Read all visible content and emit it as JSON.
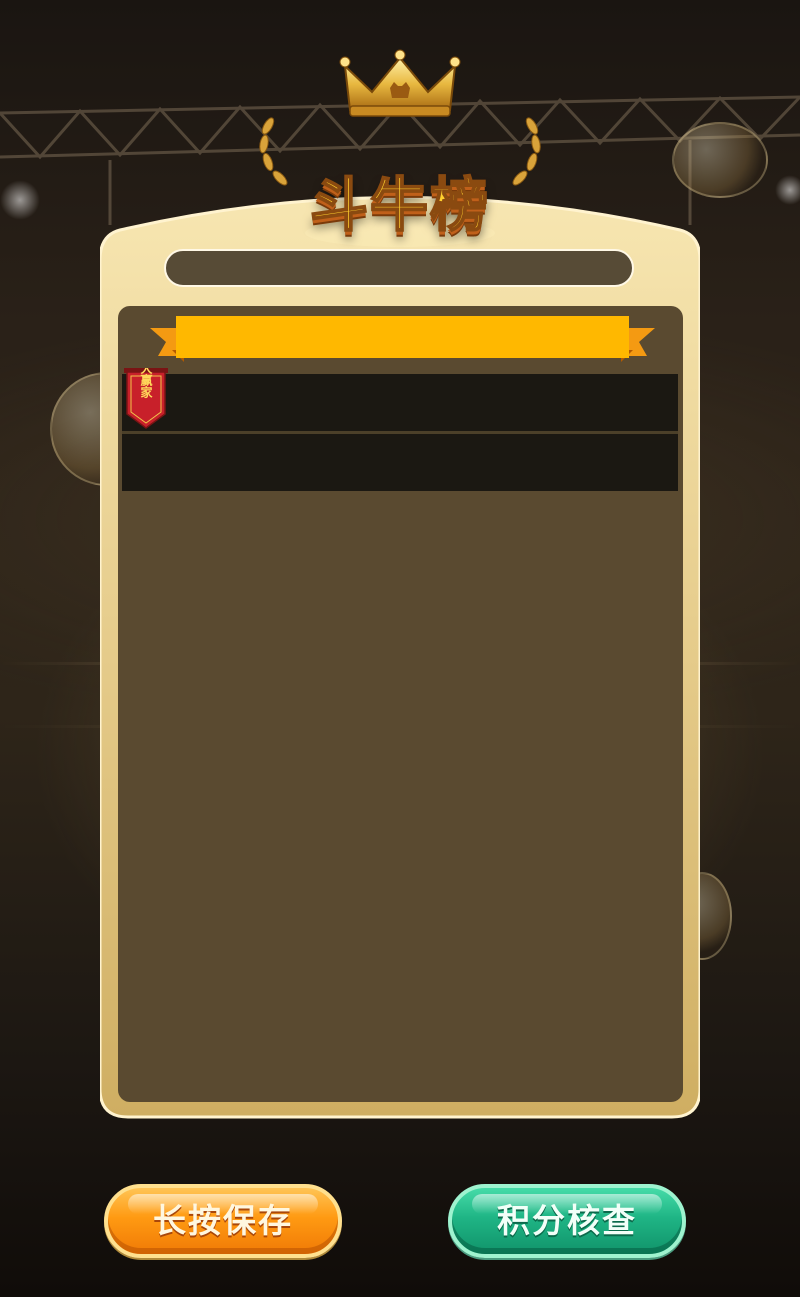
{
  "header": {
    "title": "斗牛榜",
    "logo_icon": "crown-icon"
  },
  "panel": {
    "name_bar": "",
    "ribbon_label": "",
    "rows": [
      {
        "badge": "大赢家",
        "text": ""
      },
      {
        "badge": "",
        "text": ""
      }
    ]
  },
  "buttons": {
    "save_label": "长按保存",
    "check_label": "积分核查"
  },
  "colors": {
    "panel_gold": "#e9cf8e",
    "inner_brown": "#5a4a30",
    "ribbon_yellow": "#ffb800",
    "save_orange": "#ff9a12",
    "check_green": "#1fb585",
    "badge_red": "#c8202a"
  }
}
